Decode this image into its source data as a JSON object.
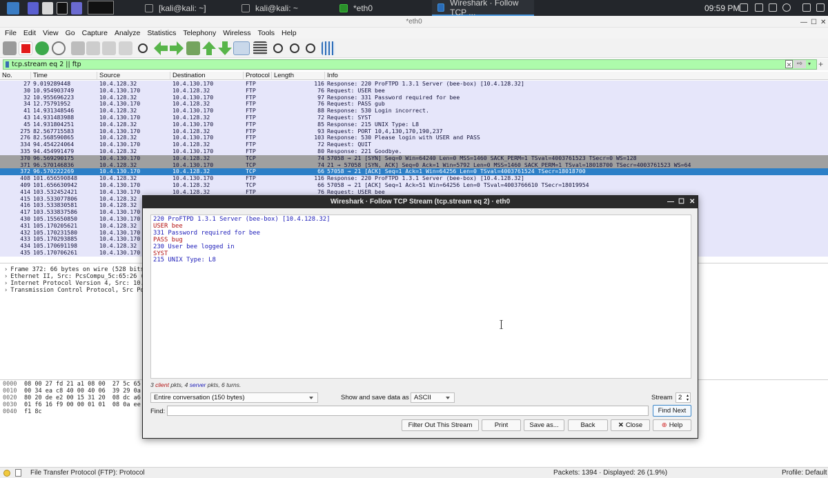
{
  "taskbar": {
    "tasks": [
      {
        "label": "[kali@kali: ~]"
      },
      {
        "label": "kali@kali: ~"
      },
      {
        "label": "*eth0"
      },
      {
        "label": "Wireshark · Follow TCP ..."
      }
    ],
    "clock": "09:59 PM"
  },
  "window": {
    "title": "*eth0"
  },
  "menu": [
    "File",
    "Edit",
    "View",
    "Go",
    "Capture",
    "Analyze",
    "Statistics",
    "Telephony",
    "Wireless",
    "Tools",
    "Help"
  ],
  "filter": {
    "value": "tcp.stream eq 2 || ftp"
  },
  "packet_list": {
    "columns": [
      "No.",
      "Time",
      "Source",
      "Destination",
      "Protocol",
      "Length",
      "Info"
    ],
    "rows": [
      {
        "no": "27",
        "time": "9.019289448",
        "src": "10.4.128.32",
        "dst": "10.4.130.170",
        "proto": "FTP",
        "len": "116",
        "info": "Response: 220 ProFTPD 1.3.1 Server (bee-box) [10.4.128.32]",
        "kind": "ftp"
      },
      {
        "no": "30",
        "time": "10.954903749",
        "src": "10.4.130.170",
        "dst": "10.4.128.32",
        "proto": "FTP",
        "len": "76",
        "info": "Request: USER bee",
        "kind": "ftp"
      },
      {
        "no": "32",
        "time": "10.955696223",
        "src": "10.4.128.32",
        "dst": "10.4.130.170",
        "proto": "FTP",
        "len": "97",
        "info": "Response: 331 Password required for bee",
        "kind": "ftp"
      },
      {
        "no": "34",
        "time": "12.75791952",
        "src": "10.4.130.170",
        "dst": "10.4.128.32",
        "proto": "FTP",
        "len": "76",
        "info": "Request: PASS gub",
        "kind": "ftp"
      },
      {
        "no": "41",
        "time": "14.931348546",
        "src": "10.4.128.32",
        "dst": "10.4.130.170",
        "proto": "FTP",
        "len": "88",
        "info": "Response: 530 Login incorrect.",
        "kind": "ftp"
      },
      {
        "no": "43",
        "time": "14.931483988",
        "src": "10.4.130.170",
        "dst": "10.4.128.32",
        "proto": "FTP",
        "len": "72",
        "info": "Request: SYST",
        "kind": "ftp"
      },
      {
        "no": "45",
        "time": "14.931804251",
        "src": "10.4.128.32",
        "dst": "10.4.130.170",
        "proto": "FTP",
        "len": "85",
        "info": "Response: 215 UNIX Type: L8",
        "kind": "ftp"
      },
      {
        "no": "275",
        "time": "82.567715583",
        "src": "10.4.130.170",
        "dst": "10.4.128.32",
        "proto": "FTP",
        "len": "93",
        "info": "Request: PORT 10,4,130,170,190,237",
        "kind": "ftp"
      },
      {
        "no": "276",
        "time": "82.568590865",
        "src": "10.4.128.32",
        "dst": "10.4.130.170",
        "proto": "FTP",
        "len": "103",
        "info": "Response: 530 Please login with USER and PASS",
        "kind": "ftp"
      },
      {
        "no": "334",
        "time": "94.454224064",
        "src": "10.4.130.170",
        "dst": "10.4.128.32",
        "proto": "FTP",
        "len": "72",
        "info": "Request: QUIT",
        "kind": "ftp"
      },
      {
        "no": "335",
        "time": "94.454991479",
        "src": "10.4.128.32",
        "dst": "10.4.130.170",
        "proto": "FTP",
        "len": "80",
        "info": "Response: 221 Goodbye.",
        "kind": "ftp"
      },
      {
        "no": "370",
        "time": "96.569290175",
        "src": "10.4.130.170",
        "dst": "10.4.128.32",
        "proto": "TCP",
        "len": "74",
        "info": "57058 → 21 [SYN] Seq=0 Win=64240 Len=0 MSS=1460 SACK_PERM=1 TSval=4003761523 TSecr=0 WS=128",
        "kind": "tcp"
      },
      {
        "no": "371",
        "time": "96.570146836",
        "src": "10.4.128.32",
        "dst": "10.4.130.170",
        "proto": "TCP",
        "len": "74",
        "info": "21 → 57058 [SYN, ACK] Seq=0 Ack=1 Win=5792 Len=0 MSS=1460 SACK_PERM=1 TSval=18018700 TSecr=4003761523 WS=64",
        "kind": "tcp"
      },
      {
        "no": "372",
        "time": "96.570222269",
        "src": "10.4.130.170",
        "dst": "10.4.128.32",
        "proto": "TCP",
        "len": "66",
        "info": "57058 → 21 [ACK] Seq=1 Ack=1 Win=64256 Len=0 TSval=4003761524 TSecr=18018700",
        "kind": "sel"
      },
      {
        "no": "408",
        "time": "101.656590848",
        "src": "10.4.128.32",
        "dst": "10.4.130.170",
        "proto": "FTP",
        "len": "116",
        "info": "Response: 220 ProFTPD 1.3.1 Server (bee-box) [10.4.128.32]",
        "kind": "ftp"
      },
      {
        "no": "409",
        "time": "101.656630942",
        "src": "10.4.130.170",
        "dst": "10.4.128.32",
        "proto": "TCP",
        "len": "66",
        "info": "57058 → 21 [ACK] Seq=1 Ack=51 Win=64256 Len=0 TSval=4003766610 TSecr=18019954",
        "kind": "ftp"
      },
      {
        "no": "414",
        "time": "103.532452421",
        "src": "10.4.130.170",
        "dst": "10.4.128.32",
        "proto": "FTP",
        "len": "76",
        "info": "Request: USER bee",
        "kind": "ftp"
      },
      {
        "no": "415",
        "time": "103.533077806",
        "src": "10.4.128.32",
        "dst": "",
        "proto": "",
        "len": "",
        "info": "",
        "kind": "ftp"
      },
      {
        "no": "416",
        "time": "103.533830581",
        "src": "10.4.128.32",
        "dst": "",
        "proto": "",
        "len": "",
        "info": "",
        "kind": "ftp"
      },
      {
        "no": "417",
        "time": "103.533837586",
        "src": "10.4.130.170",
        "dst": "",
        "proto": "",
        "len": "",
        "info": "",
        "kind": "ftp"
      },
      {
        "no": "430",
        "time": "105.155650850",
        "src": "10.4.130.170",
        "dst": "",
        "proto": "",
        "len": "",
        "info": "",
        "kind": "ftp"
      },
      {
        "no": "431",
        "time": "105.170205621",
        "src": "10.4.128.32",
        "dst": "",
        "proto": "",
        "len": "",
        "info": "",
        "kind": "ftp"
      },
      {
        "no": "432",
        "time": "105.170231580",
        "src": "10.4.130.170",
        "dst": "",
        "proto": "",
        "len": "",
        "info": "",
        "kind": "ftp"
      },
      {
        "no": "433",
        "time": "105.170293885",
        "src": "10.4.130.170",
        "dst": "",
        "proto": "",
        "len": "",
        "info": "",
        "kind": "ftp"
      },
      {
        "no": "434",
        "time": "105.170691198",
        "src": "10.4.128.32",
        "dst": "",
        "proto": "",
        "len": "",
        "info": "",
        "kind": "ftp"
      },
      {
        "no": "435",
        "time": "105.170706261",
        "src": "10.4.130.170",
        "dst": "",
        "proto": "",
        "len": "",
        "info": "",
        "kind": "ftp"
      }
    ]
  },
  "details": [
    "Frame 372: 66 bytes on wire (528 bits)",
    "Ethernet II, Src: PcsCompu_5c:65:26 (0",
    "Internet Protocol Version 4, Src: 10.4",
    "Transmission Control Protocol, Src Por"
  ],
  "bytes": [
    {
      "off": "0000",
      "hex": "08 00 27 fd 21 a1 08 00  27 5c 65 2"
    },
    {
      "off": "0010",
      "hex": "00 34 ea c8 40 00 40 06  39 29 0a 0"
    },
    {
      "off": "0020",
      "hex": "80 20 de e2 00 15 31 20  08 dc a6 0"
    },
    {
      "off": "0030",
      "hex": "01 f6 16 f9 00 00 01 01  08 0a ee a"
    },
    {
      "off": "0040",
      "hex": "f1 8c"
    }
  ],
  "status": {
    "text": "File Transfer Protocol (FTP): Protocol",
    "packets": "Packets: 1394 · Displayed: 26 (1.9%)",
    "profile": "Profile: Default"
  },
  "dialog": {
    "title": "Wireshark · Follow TCP Stream (tcp.stream eq 2) · eth0",
    "stream_lines": [
      {
        "text": "220 ProFTPD 1.3.1 Server (bee-box) [10.4.128.32]",
        "side": "server"
      },
      {
        "text": "USER bee",
        "side": "client"
      },
      {
        "text": "331 Password required for bee",
        "side": "server"
      },
      {
        "text": "PASS bug",
        "side": "client"
      },
      {
        "text": "230 User bee logged in",
        "side": "server"
      },
      {
        "text": "SYST",
        "side": "client"
      },
      {
        "text": "215 UNIX Type: L8",
        "side": "server"
      }
    ],
    "summary": {
      "client_count": "3",
      "client_word": "client",
      "pkts1": " pkts, ",
      "server_count": "4",
      "server_word": "server",
      "pkts2": " pkts, 6 turns."
    },
    "conversation": "Entire conversation (150 bytes)",
    "show_as_label": "Show and save data as",
    "show_as_value": "ASCII",
    "stream_label": "Stream",
    "stream_value": "2",
    "find_label": "Find:",
    "find_next": "Find Next",
    "buttons": {
      "filter_out": "Filter Out This Stream",
      "print": "Print",
      "save_as": "Save as...",
      "back": "Back",
      "close": "Close",
      "help": "Help"
    }
  },
  "colors": {
    "ftp_row": "#e6e6fa",
    "tcp_row": "#a0a0a0",
    "selected_row": "#2c7fc7",
    "filter_ok": "#adfbab",
    "client_text": "#b31212",
    "server_text": "#1a1ab8"
  }
}
